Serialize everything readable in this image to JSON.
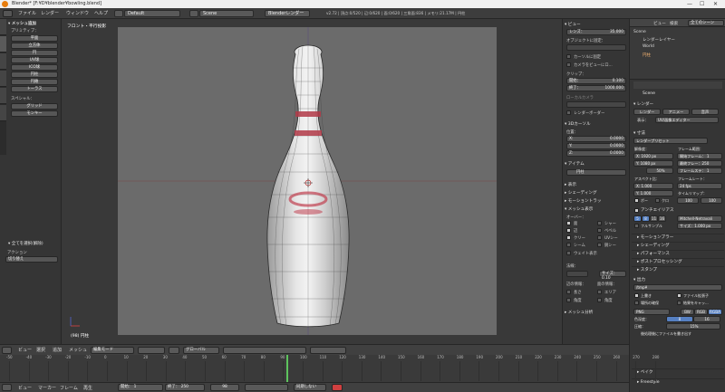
{
  "window": {
    "title": "Blender* [F:¥D¥blender¥bowling.blend]",
    "minimize": "—",
    "maximize": "☐",
    "close": "✕"
  },
  "menubar": {
    "items": [
      "ファイル",
      "レンダー",
      "ウィンドウ",
      "ヘルプ"
    ],
    "layout": "Default",
    "scene": "Scene",
    "engine": "Blenderレンダー",
    "stats": "v2.72 | 頂点:0/520 | 辺:0/620 | 面:0/620 | 三角面:836 | メモリ:21.17M | 円柱"
  },
  "toolshelf": {
    "tabs": [
      "ツール",
      "作成",
      "関係",
      "アニメーション",
      "物理演算",
      "グリース"
    ],
    "header": "▾ メッシュ追加",
    "primitive_label": "プリミティブ：",
    "primitives": [
      "平面",
      "立方体",
      "円",
      "UV球",
      "ICO球",
      "円柱",
      "円錐",
      "トーラス"
    ],
    "special_label": "スペシャル：",
    "special": [
      "グリッド",
      "モンキー"
    ],
    "op_header": "▾ 全てを選択(解除)",
    "action_label": "アクション",
    "action_value": "切り替え"
  },
  "viewport": {
    "label": "フロント・平行投影",
    "object_label": "(98) 円柱"
  },
  "npanel": {
    "view_header": "▾ ビュー",
    "lens_label": "レンズ：",
    "lens_value": "35.000",
    "lock_label": "オブジェクトに固定：",
    "lock_cursor": "カーソルに固定",
    "lock_camera": "カメラをビューにロ...",
    "clip_label": "クリップ：",
    "clip_start_label": "開始：",
    "clip_start": "0.100",
    "clip_end_label": "終了：",
    "clip_end": "1000.000",
    "local_camera": "ローカルカメラ",
    "render_border": "レンダーボーダー",
    "cursor_header": "▾ 3Dカーソル",
    "location_label": "位置：",
    "x_label": "X:",
    "x": "0.0000",
    "y_label": "Y:",
    "y": "0.0000",
    "z_label": "Z:",
    "z": "0.0000",
    "item_header": "▾ アイテム",
    "item_name": "円柱",
    "display": "▸ 表示",
    "shading": "▸ シェーディング",
    "motion": "▸ モーショントラッ",
    "mesh_display": "▾ メッシュ表示",
    "overlay_label": "オーバー：",
    "overlay": [
      "面",
      "シャー",
      "辺",
      "ベベル",
      "クリー",
      "UVシー",
      "シーム",
      "鋭シー"
    ],
    "weight": "ウェイト表示",
    "normals_label": "法線：",
    "edge_info": "辺の情報：",
    "face_info": "面の情報：",
    "size_label": "サイズ：0.10",
    "edge_opts": [
      "長さ",
      "角度"
    ],
    "face_opts": [
      "エリア",
      "角度"
    ],
    "mesh_analysis": "▸ メッシュ分析"
  },
  "outliner": {
    "menu": [
      "ビュー",
      "検索"
    ],
    "filter": "全てのシーン",
    "rows": [
      "Scene",
      "レンダーレイヤー",
      "World",
      "円柱"
    ]
  },
  "properties": {
    "breadcrumb": "Scene",
    "render_header": "▾ レンダー",
    "render_buttons": [
      "レンダー",
      "アニメー",
      "音声"
    ],
    "display_label": "表示：",
    "display_value": "UV/画像エディター",
    "dimensions_header": "▾ 寸法",
    "preset": "レンダープリセット",
    "resolution_label": "解像度：",
    "res_x": "X: 1920 px",
    "res_y": "Y: 1080 px",
    "res_pct": "50%",
    "frame_range_label": "フレーム範囲：",
    "frame_start": "開始フレーム： 1",
    "frame_end": "最終フレー：250",
    "frame_step": "フレームステ： 1",
    "aspect_label": "アスペクト比：",
    "aspect_x": "X: 1.000",
    "aspect_y": "Y: 1.000",
    "framerate_label": "フレームレート：",
    "fps": "24 fps",
    "time_remap": "タイムリマップ：",
    "remap_old": "100",
    "remap_new": "100",
    "border": "ボー",
    "crop": "クロ",
    "aa_header": "アンチエイリアス",
    "aa_samples": [
      "5",
      "8",
      "11",
      "16"
    ],
    "aa_filter": "Mitchell-Netravali",
    "full_sample": "フルサンプル",
    "aa_size": "サイズ：1.000 px",
    "sections": [
      "▸ モーションブラー",
      "▸ シェーディング",
      "▸ パフォーマンス",
      "▸ ポストプロセッシング",
      "▸ スタンプ"
    ],
    "output_header": "▾ 出力",
    "output_path": "/tmp¥",
    "overwrite": "上書き",
    "extension": "ファイル拡張子",
    "placeholder": "場所の確保",
    "cache": "結果をキャッ...",
    "format": "PNG",
    "bw": "BW",
    "rgb": "RGB",
    "rgba": "RGBA",
    "color_depth": "色深度：",
    "depth8": "8",
    "depth16": "16",
    "compression": "圧縮：",
    "compression_value": "15%",
    "sequencer": "後処理後にファイルを書き出す",
    "bake": "▸ ベイク",
    "freestyle": "▸ Freestyle"
  },
  "vpheader": {
    "menus": [
      "ビュー",
      "選択",
      "追加",
      "メッシュ"
    ],
    "mode": "編集モード",
    "orientation": "グローバル"
  },
  "timeline": {
    "ticks": [
      "-50",
      "-40",
      "-30",
      "-20",
      "-10",
      "0",
      "10",
      "20",
      "30",
      "40",
      "50",
      "60",
      "70",
      "80",
      "90",
      "100",
      "110",
      "120",
      "130",
      "140",
      "150",
      "160",
      "170",
      "180",
      "190",
      "200",
      "210",
      "220",
      "230",
      "240",
      "250",
      "260",
      "270",
      "280"
    ],
    "current_frame": 98
  },
  "tlheader": {
    "menus": [
      "ビュー",
      "マーカー",
      "フレーム",
      "再生"
    ],
    "start": "開始：",
    "start_value": "1",
    "end": "終了：",
    "end_value": "250",
    "current": "98",
    "sync": "同期しない"
  },
  "colors": {
    "accent": "#e87d0d",
    "selected": "#5680c2",
    "ring": "#b23a48"
  }
}
